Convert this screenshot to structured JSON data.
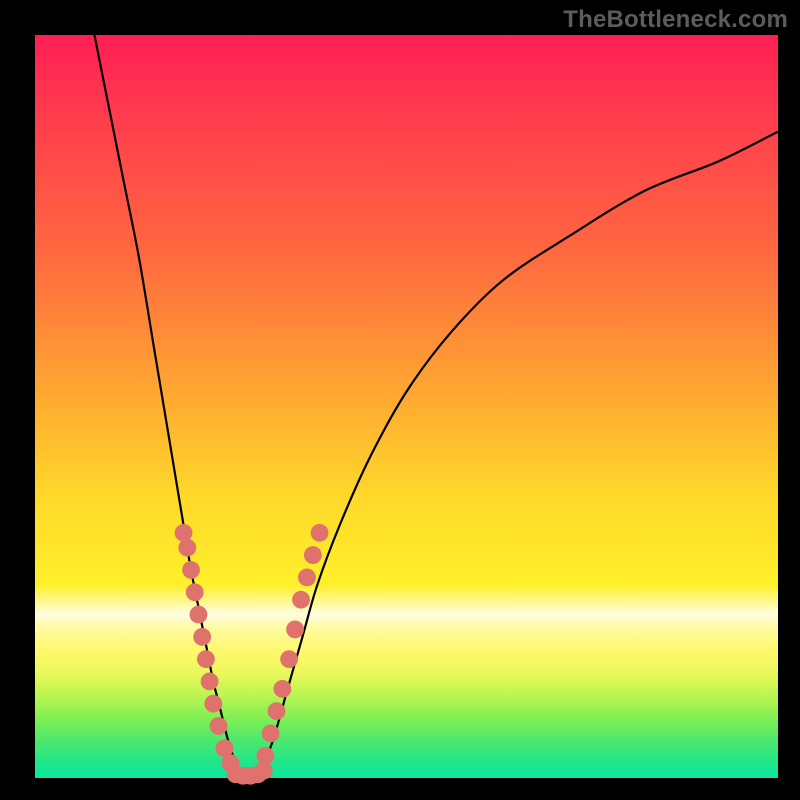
{
  "watermark": "TheBottleneck.com",
  "colors": {
    "gradient_top": "#ff1e55",
    "gradient_mid": "#ffd82a",
    "gradient_bottom": "#0ae6a0",
    "curve": "#000000",
    "dots": "#e0726d",
    "frame": "#000000"
  },
  "chart_data": {
    "type": "line",
    "title": "",
    "xlabel": "",
    "ylabel": "",
    "xlim": [
      0,
      100
    ],
    "ylim": [
      0,
      100
    ],
    "note": "Axes unlabeled; values estimated from pixel positions on a 0–100 normalized grid.",
    "series": [
      {
        "name": "left-curve",
        "x": [
          8,
          10,
          12,
          14,
          16,
          18,
          19,
          20,
          21,
          22,
          23,
          24,
          25,
          26,
          27,
          28
        ],
        "y": [
          100,
          90,
          80,
          70,
          58,
          46,
          40,
          34,
          28,
          23,
          18,
          13,
          9,
          5,
          2,
          0
        ]
      },
      {
        "name": "right-curve",
        "x": [
          30,
          32,
          34,
          36,
          38,
          41,
          45,
          50,
          56,
          63,
          72,
          82,
          92,
          100
        ],
        "y": [
          0,
          5,
          12,
          19,
          26,
          34,
          43,
          52,
          60,
          67,
          73,
          79,
          83,
          87
        ]
      }
    ],
    "points": [
      {
        "name": "left-cluster",
        "xy": [
          [
            20,
            33
          ],
          [
            20.5,
            31
          ],
          [
            21,
            28
          ],
          [
            21.5,
            25
          ],
          [
            22,
            22
          ],
          [
            22.5,
            19
          ],
          [
            23,
            16
          ],
          [
            23.5,
            13
          ],
          [
            24,
            10
          ],
          [
            24.7,
            7
          ],
          [
            25.5,
            4
          ],
          [
            26.3,
            2
          ]
        ]
      },
      {
        "name": "right-cluster",
        "xy": [
          [
            31,
            3
          ],
          [
            31.7,
            6
          ],
          [
            32.5,
            9
          ],
          [
            33.3,
            12
          ],
          [
            34.2,
            16
          ],
          [
            35,
            20
          ],
          [
            35.8,
            24
          ],
          [
            36.6,
            27
          ],
          [
            37.4,
            30
          ],
          [
            38.3,
            33
          ]
        ]
      },
      {
        "name": "valley-floor",
        "xy": [
          [
            27,
            0.5
          ],
          [
            28,
            0.3
          ],
          [
            29,
            0.3
          ],
          [
            30,
            0.5
          ],
          [
            30.8,
            1
          ]
        ]
      }
    ]
  }
}
